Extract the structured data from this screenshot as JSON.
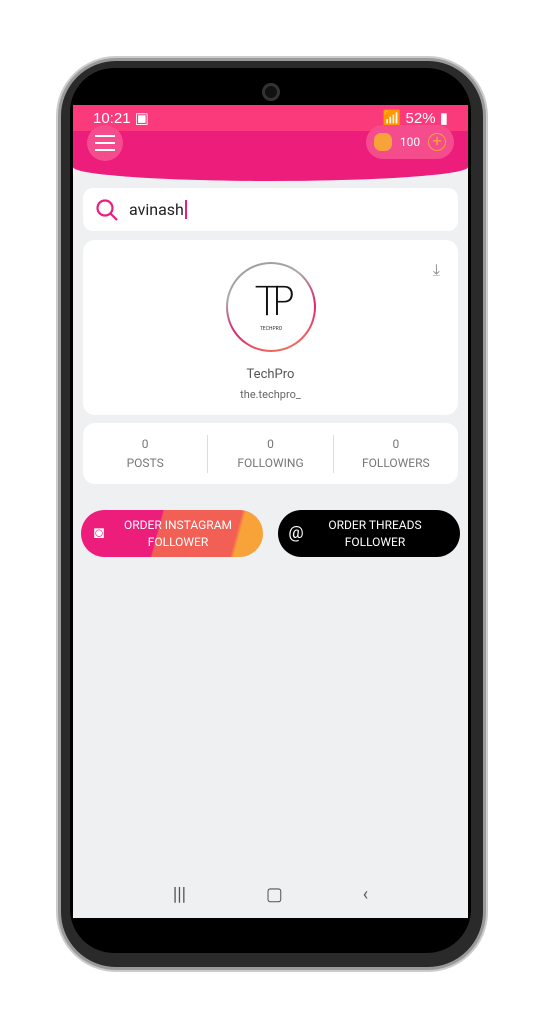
{
  "status": {
    "time": "10:21",
    "battery": "52%"
  },
  "header": {
    "coins": "100"
  },
  "search": {
    "value": "avinash"
  },
  "profile": {
    "logo_text": "TP",
    "logo_sub": "TECHPRO",
    "name": "TechPro",
    "handle": "the.techpro_"
  },
  "stats": [
    {
      "value": "0",
      "label": "POSTS"
    },
    {
      "value": "0",
      "label": "FOLLOWING"
    },
    {
      "value": "0",
      "label": "FOLLOWERS"
    }
  ],
  "buttons": {
    "instagram": "ORDER INSTAGRAM FOLLOWER",
    "threads": "ORDER THREADS FOLLOWER"
  },
  "colors": {
    "primary": "#ec1d7b",
    "status": "#fb3a7c",
    "coin": "#f8a33a"
  }
}
